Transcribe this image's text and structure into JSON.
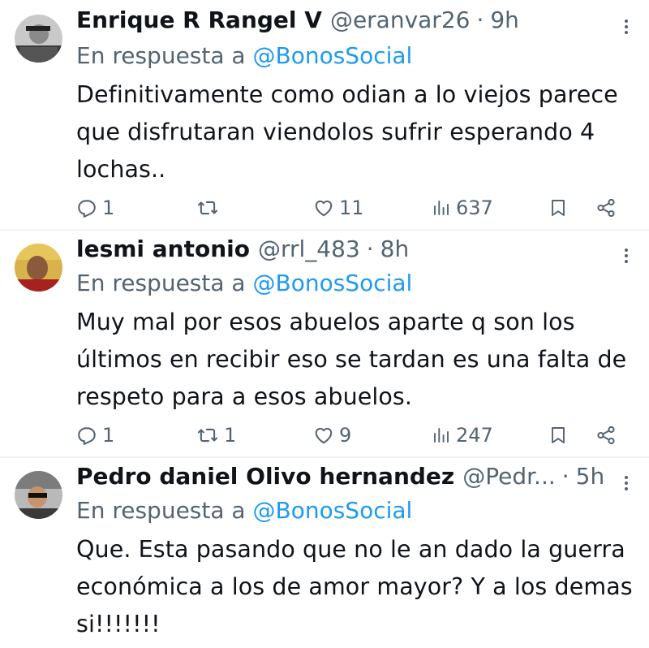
{
  "tweets": [
    {
      "name": "Enrique R Rangel V",
      "handle": "@eranvar26",
      "separator": "·",
      "time": "9h",
      "reply_prefix": "En respuesta a",
      "reply_to": "@BonosSocial",
      "text": "Definitivamente como odian a lo viejos parece que disfrutaran viendolos sufrir esperando 4 lochas..",
      "replies": "1",
      "retweets": "",
      "likes": "11",
      "views": "637"
    },
    {
      "name": "lesmi antonio",
      "handle": "@rrl_483",
      "separator": "·",
      "time": "8h",
      "reply_prefix": "En respuesta a",
      "reply_to": "@BonosSocial",
      "text": "Muy mal por esos abuelos aparte q son los últimos en recibir eso se tardan es una falta de respeto para a esos abuelos.",
      "replies": "1",
      "retweets": "1",
      "likes": "9",
      "views": "247"
    },
    {
      "name": "Pedro daniel Olivo hernandez",
      "handle": "@Pedr...",
      "separator": "·",
      "time": "5h",
      "reply_prefix": "En respuesta a",
      "reply_to": "@BonosSocial",
      "text": "Que. Esta pasando que no le an dado la guerra económica a los de amor mayor? Y a los demas si!!!!!!!"
    }
  ],
  "colors": {
    "text": "#0f1419",
    "muted": "#536471",
    "link": "#1d9bf0",
    "divider": "#eff3f4"
  },
  "icons": [
    "more-vertical-icon",
    "reply-icon",
    "retweet-icon",
    "like-icon",
    "views-icon",
    "bookmark-icon",
    "share-icon"
  ]
}
